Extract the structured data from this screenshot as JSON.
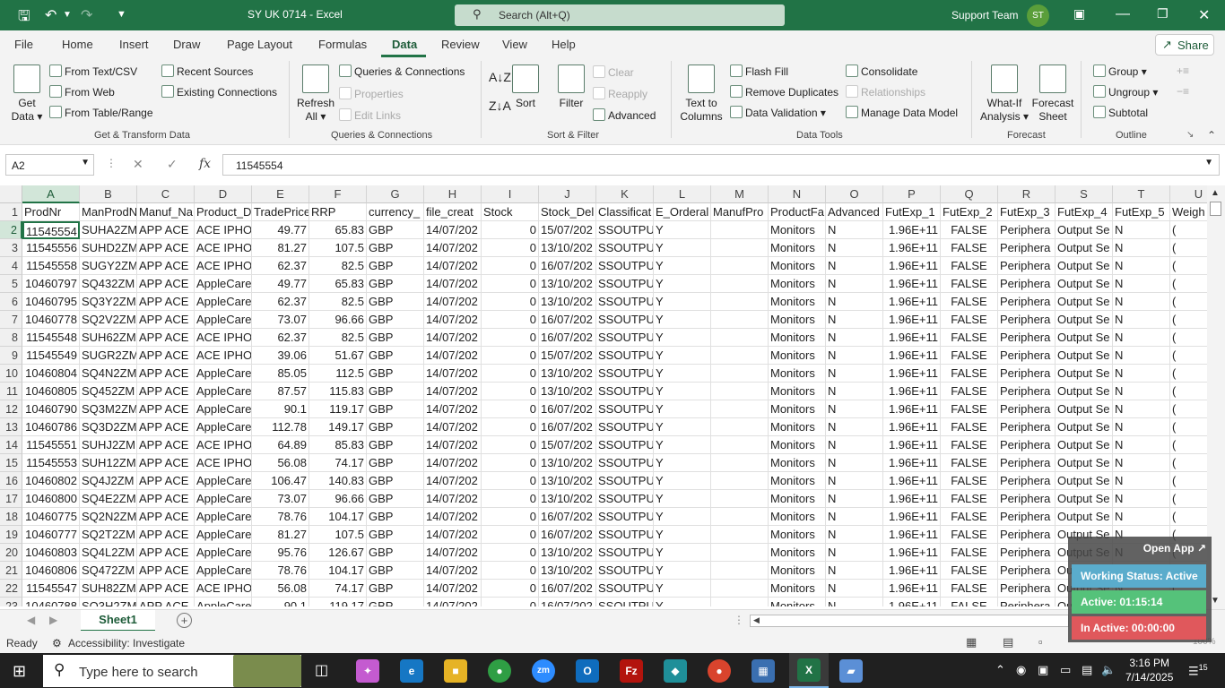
{
  "titlebar": {
    "doc_title": "SY UK 0714  -  Excel",
    "search_placeholder": "Search (Alt+Q)",
    "user_name": "Support Team",
    "user_initials": "ST"
  },
  "menu": {
    "tabs": [
      "File",
      "Home",
      "Insert",
      "Draw",
      "Page Layout",
      "Formulas",
      "Data",
      "Review",
      "View",
      "Help"
    ],
    "active": "Data",
    "share": "Share"
  },
  "ribbon": {
    "get_data": "Get Data",
    "from_text_csv": "From Text/CSV",
    "from_web": "From Web",
    "from_table_range": "From Table/Range",
    "recent_sources": "Recent Sources",
    "existing_connections": "Existing Connections",
    "group_get_transform": "Get & Transform Data",
    "refresh_all": "Refresh All",
    "queries_connections": "Queries & Connections",
    "properties": "Properties",
    "edit_links": "Edit Links",
    "group_queries": "Queries & Connections",
    "sort": "Sort",
    "filter": "Filter",
    "clear": "Clear",
    "reapply": "Reapply",
    "advanced": "Advanced",
    "group_sort_filter": "Sort & Filter",
    "text_to_columns": "Text to Columns",
    "flash_fill": "Flash Fill",
    "remove_duplicates": "Remove Duplicates",
    "data_validation": "Data Validation",
    "consolidate": "Consolidate",
    "relationships": "Relationships",
    "manage_data_model": "Manage Data Model",
    "group_data_tools": "Data Tools",
    "what_if": "What-If Analysis",
    "forecast_sheet": "Forecast Sheet",
    "group_forecast": "Forecast",
    "group_btn": "Group",
    "ungroup": "Ungroup",
    "subtotal": "Subtotal",
    "group_outline": "Outline"
  },
  "formula_bar": {
    "name_box": "A2",
    "fx": "fx",
    "value": "11545554"
  },
  "grid": {
    "columns": [
      {
        "letter": "A",
        "header": "ProdNr",
        "w": 64
      },
      {
        "letter": "B",
        "header": "ManProdN",
        "w": 64
      },
      {
        "letter": "C",
        "header": "Manuf_Na",
        "w": 64
      },
      {
        "letter": "D",
        "header": "Product_D",
        "w": 64
      },
      {
        "letter": "E",
        "header": "TradePrice",
        "w": 64
      },
      {
        "letter": "F",
        "header": "RRP",
        "w": 64
      },
      {
        "letter": "G",
        "header": "currency_",
        "w": 64
      },
      {
        "letter": "H",
        "header": "file_creat",
        "w": 64
      },
      {
        "letter": "I",
        "header": "Stock",
        "w": 64
      },
      {
        "letter": "J",
        "header": "Stock_Del",
        "w": 64
      },
      {
        "letter": "K",
        "header": "Classificat",
        "w": 64
      },
      {
        "letter": "L",
        "header": "E_Orderal",
        "w": 64
      },
      {
        "letter": "M",
        "header": "ManufPro",
        "w": 64
      },
      {
        "letter": "N",
        "header": "ProductFa",
        "w": 64
      },
      {
        "letter": "O",
        "header": "Advanced",
        "w": 64
      },
      {
        "letter": "P",
        "header": "FutExp_1",
        "w": 64
      },
      {
        "letter": "Q",
        "header": "FutExp_2",
        "w": 64
      },
      {
        "letter": "R",
        "header": "FutExp_3",
        "w": 64
      },
      {
        "letter": "S",
        "header": "FutExp_4",
        "w": 64
      },
      {
        "letter": "T",
        "header": "FutExp_5",
        "w": 64
      },
      {
        "letter": "U",
        "header": "Weigh",
        "w": 64
      }
    ],
    "rows": [
      [
        "11545554",
        "SUHA2ZM",
        "APP ACE",
        "ACE IPHO",
        "49.77",
        "65.83",
        "GBP",
        "14/07/202",
        "0",
        "15/07/202",
        "SSOUTPU",
        "Y",
        "",
        "Monitors",
        "N",
        "1.96E+11",
        "FALSE",
        "Periphera",
        "Output Se",
        "N",
        "("
      ],
      [
        "11545556",
        "SUHD2ZM",
        "APP ACE",
        "ACE IPHO",
        "81.27",
        "107.5",
        "GBP",
        "14/07/202",
        "0",
        "13/10/202",
        "SSOUTPU",
        "Y",
        "",
        "Monitors",
        "N",
        "1.96E+11",
        "FALSE",
        "Periphera",
        "Output Se",
        "N",
        "("
      ],
      [
        "11545558",
        "SUGY2ZM",
        "APP ACE",
        "ACE IPHO",
        "62.37",
        "82.5",
        "GBP",
        "14/07/202",
        "0",
        "16/07/202",
        "SSOUTPU",
        "Y",
        "",
        "Monitors",
        "N",
        "1.96E+11",
        "FALSE",
        "Periphera",
        "Output Se",
        "N",
        "("
      ],
      [
        "10460797",
        "SQ432ZM",
        "APP ACE",
        "AppleCare",
        "49.77",
        "65.83",
        "GBP",
        "14/07/202",
        "0",
        "13/10/202",
        "SSOUTPU",
        "Y",
        "",
        "Monitors",
        "N",
        "1.96E+11",
        "FALSE",
        "Periphera",
        "Output Se",
        "N",
        "("
      ],
      [
        "10460795",
        "SQ3Y2ZM",
        "APP ACE",
        "AppleCare",
        "62.37",
        "82.5",
        "GBP",
        "14/07/202",
        "0",
        "13/10/202",
        "SSOUTPU",
        "Y",
        "",
        "Monitors",
        "N",
        "1.96E+11",
        "FALSE",
        "Periphera",
        "Output Se",
        "N",
        "("
      ],
      [
        "10460778",
        "SQ2V2ZM",
        "APP ACE",
        "AppleCare",
        "73.07",
        "96.66",
        "GBP",
        "14/07/202",
        "0",
        "16/07/202",
        "SSOUTPU",
        "Y",
        "",
        "Monitors",
        "N",
        "1.96E+11",
        "FALSE",
        "Periphera",
        "Output Se",
        "N",
        "("
      ],
      [
        "11545548",
        "SUH62ZM",
        "APP ACE",
        "ACE IPHO",
        "62.37",
        "82.5",
        "GBP",
        "14/07/202",
        "0",
        "16/07/202",
        "SSOUTPU",
        "Y",
        "",
        "Monitors",
        "N",
        "1.96E+11",
        "FALSE",
        "Periphera",
        "Output Se",
        "N",
        "("
      ],
      [
        "11545549",
        "SUGR2ZM",
        "APP ACE",
        "ACE IPHO",
        "39.06",
        "51.67",
        "GBP",
        "14/07/202",
        "0",
        "15/07/202",
        "SSOUTPU",
        "Y",
        "",
        "Monitors",
        "N",
        "1.96E+11",
        "FALSE",
        "Periphera",
        "Output Se",
        "N",
        "("
      ],
      [
        "10460804",
        "SQ4N2ZM",
        "APP ACE",
        "AppleCare",
        "85.05",
        "112.5",
        "GBP",
        "14/07/202",
        "0",
        "13/10/202",
        "SSOUTPU",
        "Y",
        "",
        "Monitors",
        "N",
        "1.96E+11",
        "FALSE",
        "Periphera",
        "Output Se",
        "N",
        "("
      ],
      [
        "10460805",
        "SQ452ZM",
        "APP ACE",
        "AppleCare",
        "87.57",
        "115.83",
        "GBP",
        "14/07/202",
        "0",
        "13/10/202",
        "SSOUTPU",
        "Y",
        "",
        "Monitors",
        "N",
        "1.96E+11",
        "FALSE",
        "Periphera",
        "Output Se",
        "N",
        "("
      ],
      [
        "10460790",
        "SQ3M2ZM",
        "APP ACE",
        "AppleCare",
        "90.1",
        "119.17",
        "GBP",
        "14/07/202",
        "0",
        "16/07/202",
        "SSOUTPU",
        "Y",
        "",
        "Monitors",
        "N",
        "1.96E+11",
        "FALSE",
        "Periphera",
        "Output Se",
        "N",
        "("
      ],
      [
        "10460786",
        "SQ3D2ZM",
        "APP ACE",
        "AppleCare",
        "112.78",
        "149.17",
        "GBP",
        "14/07/202",
        "0",
        "16/07/202",
        "SSOUTPU",
        "Y",
        "",
        "Monitors",
        "N",
        "1.96E+11",
        "FALSE",
        "Periphera",
        "Output Se",
        "N",
        "("
      ],
      [
        "11545551",
        "SUHJ2ZM",
        "APP ACE",
        "ACE IPHO",
        "64.89",
        "85.83",
        "GBP",
        "14/07/202",
        "0",
        "15/07/202",
        "SSOUTPU",
        "Y",
        "",
        "Monitors",
        "N",
        "1.96E+11",
        "FALSE",
        "Periphera",
        "Output Se",
        "N",
        "("
      ],
      [
        "11545553",
        "SUH12ZM",
        "APP ACE",
        "ACE IPHO",
        "56.08",
        "74.17",
        "GBP",
        "14/07/202",
        "0",
        "13/10/202",
        "SSOUTPU",
        "Y",
        "",
        "Monitors",
        "N",
        "1.96E+11",
        "FALSE",
        "Periphera",
        "Output Se",
        "N",
        "("
      ],
      [
        "10460802",
        "SQ4J2ZM",
        "APP ACE",
        "AppleCare",
        "106.47",
        "140.83",
        "GBP",
        "14/07/202",
        "0",
        "13/10/202",
        "SSOUTPU",
        "Y",
        "",
        "Monitors",
        "N",
        "1.96E+11",
        "FALSE",
        "Periphera",
        "Output Se",
        "N",
        "("
      ],
      [
        "10460800",
        "SQ4E2ZM",
        "APP ACE",
        "AppleCare",
        "73.07",
        "96.66",
        "GBP",
        "14/07/202",
        "0",
        "13/10/202",
        "SSOUTPU",
        "Y",
        "",
        "Monitors",
        "N",
        "1.96E+11",
        "FALSE",
        "Periphera",
        "Output Se",
        "N",
        "("
      ],
      [
        "10460775",
        "SQ2N2ZM",
        "APP ACE",
        "AppleCare",
        "78.76",
        "104.17",
        "GBP",
        "14/07/202",
        "0",
        "16/07/202",
        "SSOUTPU",
        "Y",
        "",
        "Monitors",
        "N",
        "1.96E+11",
        "FALSE",
        "Periphera",
        "Output Se",
        "N",
        "("
      ],
      [
        "10460777",
        "SQ2T2ZM",
        "APP ACE",
        "AppleCare",
        "81.27",
        "107.5",
        "GBP",
        "14/07/202",
        "0",
        "16/07/202",
        "SSOUTPU",
        "Y",
        "",
        "Monitors",
        "N",
        "1.96E+11",
        "FALSE",
        "Periphera",
        "Output Se",
        "N",
        "("
      ],
      [
        "10460803",
        "SQ4L2ZM",
        "APP ACE",
        "AppleCare",
        "95.76",
        "126.67",
        "GBP",
        "14/07/202",
        "0",
        "13/10/202",
        "SSOUTPU",
        "Y",
        "",
        "Monitors",
        "N",
        "1.96E+11",
        "FALSE",
        "Periphera",
        "Output Se",
        "N",
        "("
      ],
      [
        "10460806",
        "SQ472ZM",
        "APP ACE",
        "AppleCare",
        "78.76",
        "104.17",
        "GBP",
        "14/07/202",
        "0",
        "13/10/202",
        "SSOUTPU",
        "Y",
        "",
        "Monitors",
        "N",
        "1.96E+11",
        "FALSE",
        "Periphera",
        "Output Se",
        "N",
        "("
      ],
      [
        "11545547",
        "SUH82ZM",
        "APP ACE",
        "ACE IPHO",
        "56.08",
        "74.17",
        "GBP",
        "14/07/202",
        "0",
        "16/07/202",
        "SSOUTPU",
        "Y",
        "",
        "Monitors",
        "N",
        "1.96E+11",
        "FALSE",
        "Periphera",
        "Output Se",
        "N",
        "("
      ],
      [
        "10460788",
        "SQ3H2ZM",
        "APP ACE",
        "AppleCare",
        "90.1",
        "119.17",
        "GBP",
        "14/07/202",
        "0",
        "16/07/202",
        "SSOUTPU",
        "Y",
        "",
        "Monitors",
        "N",
        "1.96E+11",
        "FALSE",
        "Periphera",
        "Output Se",
        "N",
        "("
      ]
    ]
  },
  "sheet": {
    "tab": "Sheet1"
  },
  "status": {
    "ready": "Ready",
    "accessibility": "Accessibility: Investigate",
    "zoom": "100%"
  },
  "widget": {
    "open_app": "Open App",
    "working_status": "Working Status: Active",
    "active_time": "Active: 01:15:14",
    "inactive_time": "In Active: 00:00:00"
  },
  "taskbar": {
    "search_placeholder": "Type here to search",
    "time": "3:16 PM",
    "date": "7/14/2025",
    "notifications": "15"
  },
  "colors": {
    "excel_green": "#217346",
    "widget_blue": "#5aaccc",
    "widget_green": "#55c27a",
    "widget_red": "#e0585c"
  }
}
